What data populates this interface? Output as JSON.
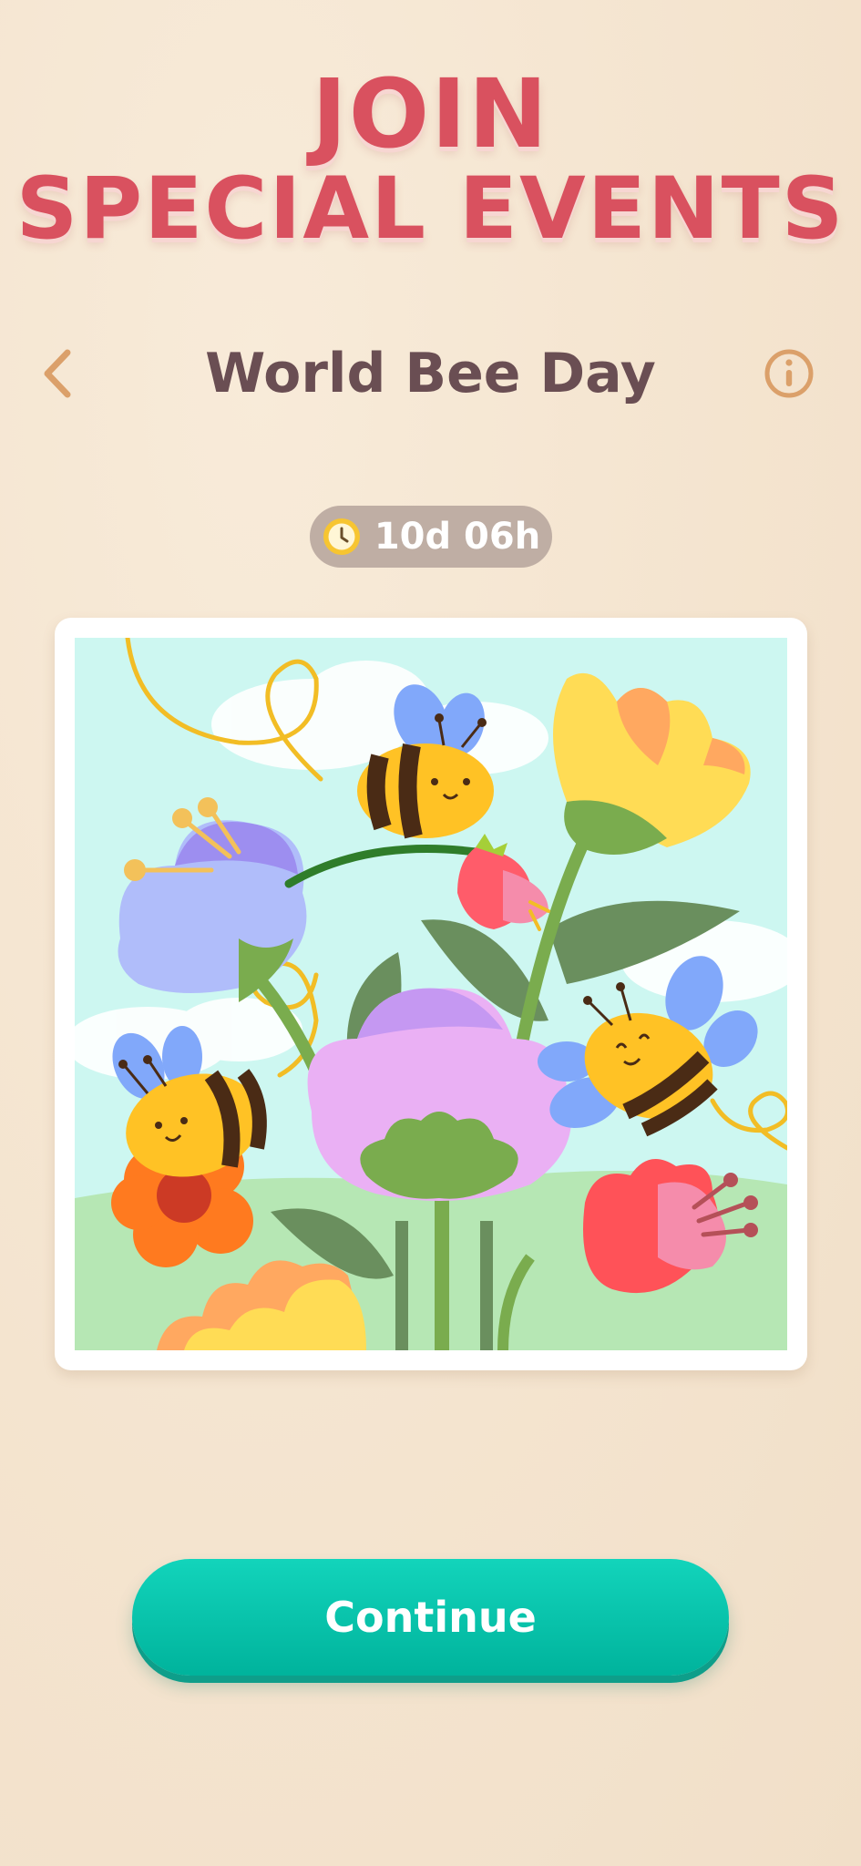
{
  "promo": {
    "line1": "JOIN",
    "line2": "SPECIAL EVENTS"
  },
  "header": {
    "title": "World Bee Day",
    "back_icon": "chevron-left-icon",
    "info_icon": "info-icon"
  },
  "timer": {
    "icon": "clock-icon",
    "text": "10d 06h"
  },
  "artwork": {
    "subject": "bees-and-flowers-illustration"
  },
  "actions": {
    "continue_label": "Continue"
  },
  "colors": {
    "title": "#d9515f",
    "heading": "#6a4e53",
    "accent": "#dba06a",
    "button": "#00c4a8",
    "timer_pill": "#bfaea4"
  }
}
